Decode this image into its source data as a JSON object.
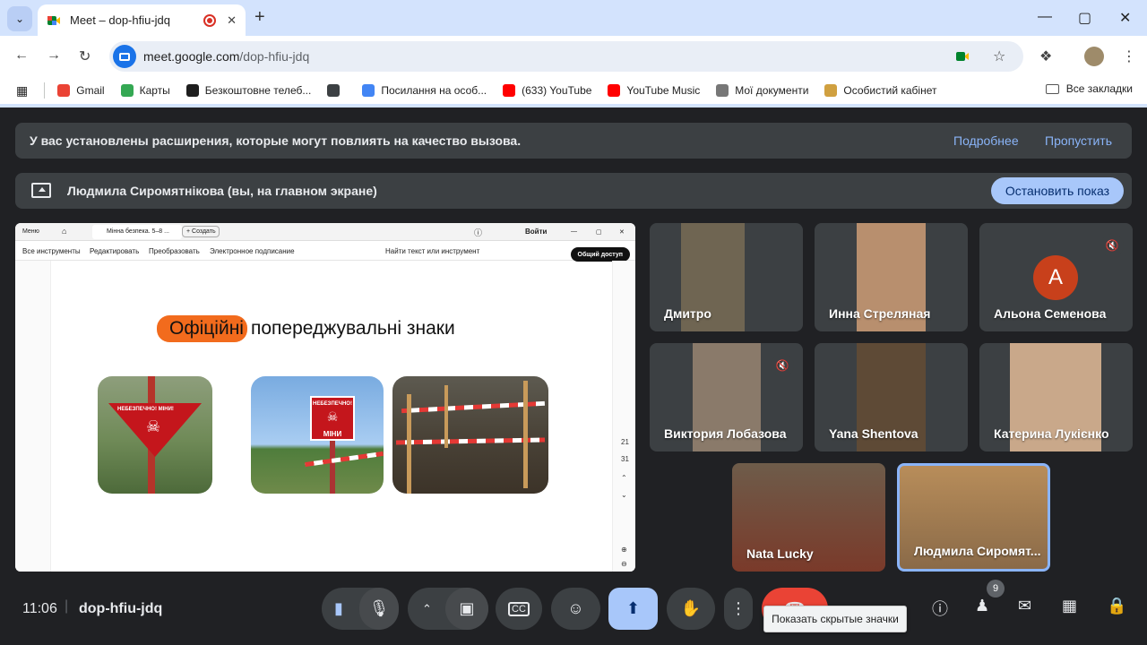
{
  "browser": {
    "tab_title": "Meet – dop-hfiu-jdq",
    "url_host": "meet.google.com",
    "url_path": "/dop-hfiu-jdq",
    "new_tab": "+",
    "bookmarks": [
      {
        "label": "Gmail",
        "color": "#ea4335"
      },
      {
        "label": "Карты",
        "color": "#34a853"
      },
      {
        "label": "Безкоштовне телеб...",
        "color": "#1e1e1e"
      },
      {
        "label": "",
        "color": "#3c4043"
      },
      {
        "label": "Посилання на особ...",
        "color": "#4285f4"
      },
      {
        "label": "(633) YouTube",
        "color": "#ff0000"
      },
      {
        "label": "YouTube Music",
        "color": "#ff0000"
      },
      {
        "label": "Мої документи",
        "color": "#777777"
      },
      {
        "label": "Особистий кабінет",
        "color": "#d0a040"
      }
    ],
    "all_bookmarks": "Все закладки"
  },
  "banners": {
    "extensions_text": "У вас установлены расширения, которые могут повлиять на качество вызова.",
    "more": "Подробнее",
    "skip": "Пропустить",
    "presenting_text": "Людмила Сиромятнікова (вы, на главном экране)",
    "stop_sharing": "Остановить показ"
  },
  "shared_screen": {
    "top_menu": "Меню",
    "doc_tab": "Мінна безпека. 5–8 ...",
    "create": "+ Создать",
    "login": "Войти",
    "menu_items": [
      "Все инструменты",
      "Редактировать",
      "Преобразовать",
      "Электронное подписание"
    ],
    "search": "Найти текст или инструмент",
    "share": "Общий доступ",
    "page_num_a": "21",
    "page_num_b": "31",
    "slide_title_highlight": "Офіційні",
    "slide_title_rest": "попереджувальні знаки",
    "sign1_text": "НЕБЕЗПЕЧНО! МІНИ!",
    "sign2_line1": "НЕБЕЗПЕЧНО!",
    "sign2_line2": "МІНИ"
  },
  "participants": [
    {
      "name": "Дмитро",
      "muted": false
    },
    {
      "name": "Инна Стреляная",
      "muted": false
    },
    {
      "name": "Альона Семенова",
      "muted": true,
      "initial": "А"
    },
    {
      "name": "Виктория Лобазова",
      "muted": true
    },
    {
      "name": "Yana Shentova",
      "muted": false
    },
    {
      "name": "Катерина Лукієнко",
      "muted": false
    },
    {
      "name": "Nata Lucky",
      "muted": false
    },
    {
      "name": "Людмила Сиромят...",
      "muted": false,
      "active": true
    }
  ],
  "bottom": {
    "time": "11:06",
    "separator": "|",
    "meeting_code": "dop-hfiu-jdq",
    "people_count": "9",
    "tooltip": "Показать скрытые значки"
  }
}
